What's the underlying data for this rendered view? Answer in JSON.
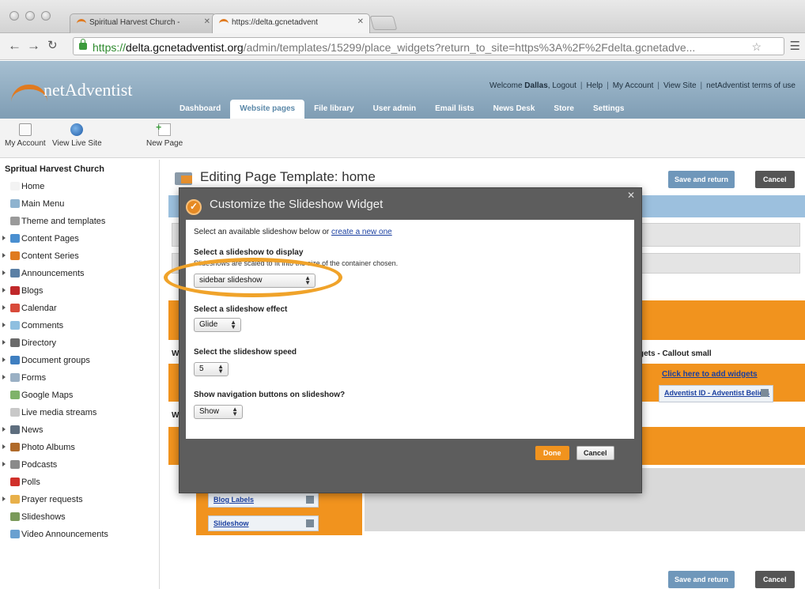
{
  "browser": {
    "tabs": [
      {
        "title": "Spiritual Harvest Church - "
      },
      {
        "title": "https://delta.gcnetadvent"
      }
    ],
    "url": {
      "scheme": "https://",
      "host": "delta.gcnetadventist.org",
      "path": "/admin/templates/15299/place_widgets?return_to_site=https%3A%2F%2Fdelta.gcnetadve..."
    }
  },
  "app": {
    "logo_text": "netAdventist",
    "welcome_prefix": "Welcome",
    "user": "Dallas",
    "toplinks": [
      "Logout",
      "Help",
      "My Account",
      "View Site",
      "netAdventist terms of use"
    ],
    "nav_tabs": [
      "Dashboard",
      "Website pages",
      "File library",
      "User admin",
      "Email lists",
      "News Desk",
      "Store",
      "Settings"
    ],
    "active_tab": "Website pages"
  },
  "quickbar": [
    {
      "label": "My Account",
      "icon": "account-icon"
    },
    {
      "label": "View Live Site",
      "icon": "globe-icon"
    },
    {
      "label": "New Page",
      "icon": "new-page-icon"
    }
  ],
  "sidebar": {
    "site_name": "Spritual Harvest Church",
    "items": [
      {
        "label": "Home",
        "icon": "home-icon",
        "expandable": false,
        "color": "#f3f3f3"
      },
      {
        "label": "Main Menu",
        "icon": "menu-icon",
        "expandable": false,
        "color": "#8fb3cf"
      },
      {
        "label": "Theme and templates",
        "icon": "theme-icon",
        "expandable": false,
        "color": "#9a9a9a"
      },
      {
        "label": "Content Pages",
        "icon": "content-pages-icon",
        "expandable": true,
        "color": "#4a8fd0"
      },
      {
        "label": "Content Series",
        "icon": "content-series-icon",
        "expandable": true,
        "color": "#e07a1f"
      },
      {
        "label": "Announcements",
        "icon": "announcements-icon",
        "expandable": true,
        "color": "#5a7fa5"
      },
      {
        "label": "Blogs",
        "icon": "blogs-icon",
        "expandable": true,
        "color": "#c0282a"
      },
      {
        "label": "Calendar",
        "icon": "calendar-icon",
        "expandable": true,
        "color": "#d84a3a"
      },
      {
        "label": "Comments",
        "icon": "comments-icon",
        "expandable": true,
        "color": "#8fbfe0"
      },
      {
        "label": "Directory",
        "icon": "directory-icon",
        "expandable": true,
        "color": "#6a6a6a"
      },
      {
        "label": "Document groups",
        "icon": "document-groups-icon",
        "expandable": true,
        "color": "#3f7fc0"
      },
      {
        "label": "Forms",
        "icon": "forms-icon",
        "expandable": true,
        "color": "#9ab0c4"
      },
      {
        "label": "Google Maps",
        "icon": "map-icon",
        "expandable": false,
        "color": "#7fb36a"
      },
      {
        "label": "Live media streams",
        "icon": "media-icon",
        "expandable": false,
        "color": "#c8c8c8"
      },
      {
        "label": "News",
        "icon": "news-icon",
        "expandable": true,
        "color": "#5e6e7e"
      },
      {
        "label": "Photo Albums",
        "icon": "photo-icon",
        "expandable": true,
        "color": "#b06a2a"
      },
      {
        "label": "Podcasts",
        "icon": "podcast-icon",
        "expandable": true,
        "color": "#8a8a8a"
      },
      {
        "label": "Polls",
        "icon": "polls-icon",
        "expandable": false,
        "color": "#d0302a"
      },
      {
        "label": "Prayer requests",
        "icon": "prayer-icon",
        "expandable": true,
        "color": "#e8b04a"
      },
      {
        "label": "Slideshows",
        "icon": "slideshow-icon",
        "expandable": false,
        "color": "#7a9a5a"
      },
      {
        "label": "Video Announcements",
        "icon": "video-icon",
        "expandable": false,
        "color": "#6aa0d0"
      }
    ]
  },
  "main": {
    "page_title": "Editing Page Template: home",
    "save_label": "Save and return",
    "cancel_label": "Cancel",
    "bg_w_1": "W",
    "bg_w_2": "W",
    "callout_heading": "gets - Callout small",
    "add_widgets_link": "Click here to add widgets",
    "widget_adventist": "Adventist ID - Adventist Beliefs",
    "widget_blog_labels": "Blog Labels",
    "widget_slideshow": "Slideshow"
  },
  "modal": {
    "title": "Customize the Slideshow Widget",
    "intro_text": "Select an available slideshow below or",
    "intro_link": "create a new one",
    "slideshow_label": "Select a slideshow to display",
    "slideshow_help": "Slideshows are scaled to fit into the size of the container chosen.",
    "slideshow_value": "sidebar slideshow",
    "effect_label": "Select a slideshow effect",
    "effect_value": "Glide",
    "speed_label": "Select the slideshow speed",
    "speed_value": "5",
    "nav_label": "Show navigation buttons on slideshow?",
    "nav_value": "Show",
    "done_label": "Done",
    "cancel_label": "Cancel"
  },
  "colors": {
    "accent_orange": "#f1931e",
    "header_blue": "#8fabc0",
    "modal_frame": "#5d5d5d",
    "highlight": "#f0a32a"
  }
}
